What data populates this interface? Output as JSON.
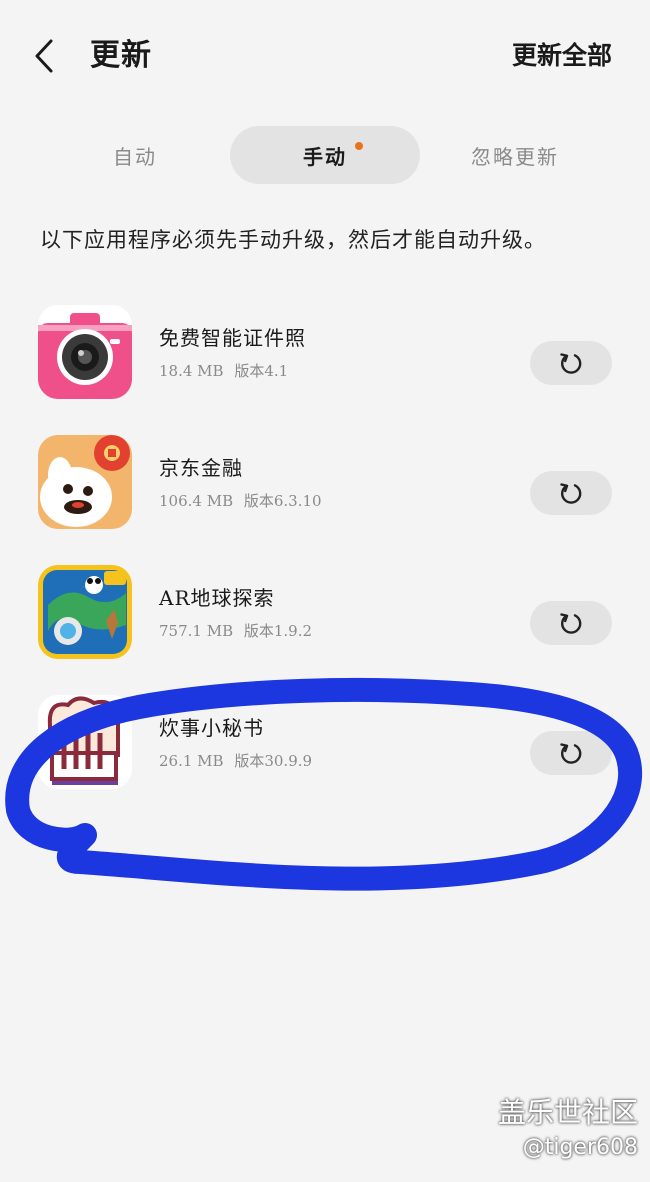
{
  "header": {
    "back_icon": "chevron-left-icon",
    "title": "更新",
    "update_all_label": "更新全部"
  },
  "tabs": [
    {
      "label": "自动",
      "active": false
    },
    {
      "label": "手动",
      "active": true,
      "has_badge": true
    },
    {
      "label": "忽略更新",
      "active": false
    }
  ],
  "notice": "以下应用程序必须先手动升级，然后才能自动升级。",
  "apps": [
    {
      "name": "免费智能证件照",
      "size": "18.4 MB",
      "version": "版本4.1",
      "icon": "camera-app-icon"
    },
    {
      "name": "京东金融",
      "size": "106.4 MB",
      "version": "版本6.3.10",
      "icon": "jd-finance-icon"
    },
    {
      "name": "AR地球探索",
      "size": "757.1 MB",
      "version": "版本1.9.2",
      "icon": "ar-earth-icon"
    },
    {
      "name": "炊事小秘书",
      "size": "26.1 MB",
      "version": "版本30.9.9",
      "icon": "chef-hat-icon"
    }
  ],
  "update_button_icon": "refresh-icon",
  "colors": {
    "background": "#f4f4f4",
    "tab_active_bg": "#e3e3e3",
    "badge_dot": "#e8731f",
    "annotation_stroke": "#1c36e0"
  },
  "watermark": {
    "line1": "盖乐世社区",
    "line2": "@tiger608"
  }
}
